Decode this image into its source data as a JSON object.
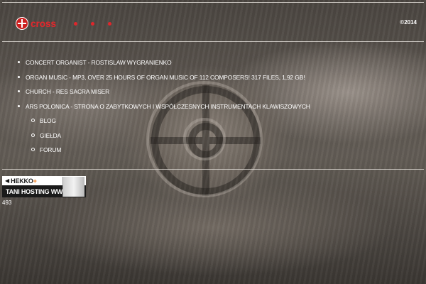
{
  "header": {
    "logo_text": "cross",
    "logo_icon": "cross-circle-icon",
    "copyright": "©2014",
    "accent_color": "#e3262b"
  },
  "nav": {
    "items": [
      {
        "label": "CONCERT ORGANIST - ROSTISLAW WYGRANIENKO"
      },
      {
        "label": "ORGAN MUSIC - MP3, OVER 25 HOURS OF ORGAN MUSIC OF 112 COMPOSERS! 317 FILES, 1,92 GB!"
      },
      {
        "label": "CHURCH - RES SACRA MISER"
      },
      {
        "label": "ARS POLONICA - STRONA O ZABYTKOWYCH I WSPÓŁCZESNYCH INSTRUMENTACH KLAWISZOWYCH"
      }
    ],
    "subitems": [
      {
        "label": "BLOG"
      },
      {
        "label": "GIEŁDA"
      },
      {
        "label": "FORUM"
      }
    ]
  },
  "banner": {
    "brand": "HEKKO",
    "brand_suffix": "+",
    "tagline": "TANI HOSTING WWW"
  },
  "footer": {
    "counter": "493"
  }
}
